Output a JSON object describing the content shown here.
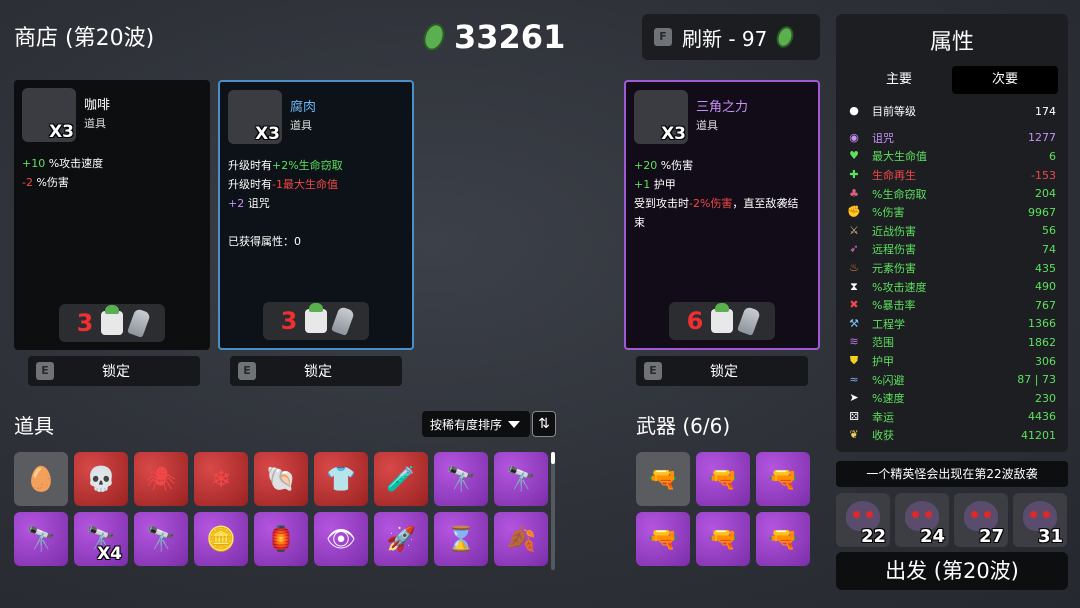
{
  "shop_title": "商店 (第20波)",
  "currency": "33261",
  "refresh": {
    "key": "F",
    "label": "刷新 - 97"
  },
  "cards": [
    {
      "name": "咖啡",
      "type": "道具",
      "qty": "X3",
      "rarity": "common",
      "effects": [
        [
          {
            "t": "+10",
            "c": "green"
          },
          {
            "t": " %攻击速度",
            "c": ""
          }
        ],
        [
          {
            "t": "-2",
            "c": "red"
          },
          {
            "t": " %伤害",
            "c": ""
          }
        ]
      ],
      "price": "3",
      "lock_key": "E",
      "lock_label": "锁定"
    },
    {
      "name": "腐肉",
      "type": "道具",
      "qty": "X3",
      "rarity": "blue",
      "effects": [
        [
          {
            "t": "升级时有",
            "c": ""
          },
          {
            "t": "+2%生命窃取",
            "c": "green"
          }
        ],
        [
          {
            "t": "升级时有",
            "c": ""
          },
          {
            "t": "-1最大生命值",
            "c": "red"
          }
        ],
        [
          {
            "t": "+2",
            "c": "purp"
          },
          {
            "t": " 诅咒",
            "c": ""
          }
        ],
        [
          {
            "t": "",
            "c": ""
          }
        ],
        [
          {
            "t": "已获得属性：0",
            "c": ""
          }
        ]
      ],
      "price": "3",
      "lock_key": "E",
      "lock_label": "锁定"
    },
    {
      "name": "三角之力",
      "type": "道具",
      "qty": "X3",
      "rarity": "purple",
      "effects": [
        [
          {
            "t": "+20",
            "c": "green"
          },
          {
            "t": " %伤害",
            "c": ""
          }
        ],
        [
          {
            "t": "+1",
            "c": "green"
          },
          {
            "t": " 护甲",
            "c": ""
          }
        ],
        [
          {
            "t": "受到攻击时",
            "c": ""
          },
          {
            "t": "-2%伤害",
            "c": "red"
          },
          {
            "t": "，直至敌袭结",
            "c": ""
          }
        ],
        [
          {
            "t": "束",
            "c": ""
          }
        ]
      ],
      "price": "6",
      "lock_key": "E",
      "lock_label": "锁定"
    }
  ],
  "items_title": "道具",
  "sort_label": "按稀有度排序",
  "items": [
    {
      "icon": "egg-icon",
      "glyph": "🥚",
      "rarity": "white",
      "qty": ""
    },
    {
      "icon": "skull-helmet-icon",
      "glyph": "💀",
      "rarity": "red",
      "qty": ""
    },
    {
      "icon": "spider-icon",
      "glyph": "🕷",
      "rarity": "red",
      "qty": ""
    },
    {
      "icon": "snowflake-orb-icon",
      "glyph": "❄",
      "rarity": "red",
      "qty": ""
    },
    {
      "icon": "shell-icon",
      "glyph": "🐚",
      "rarity": "red",
      "qty": ""
    },
    {
      "icon": "hoodie-icon",
      "glyph": "👕",
      "rarity": "red",
      "qty": ""
    },
    {
      "icon": "test-tube-icon",
      "glyph": "🧪",
      "rarity": "red",
      "qty": ""
    },
    {
      "icon": "binoculars-icon",
      "glyph": "🔭",
      "rarity": "purple",
      "qty": ""
    },
    {
      "icon": "binoculars-icon",
      "glyph": "🔭",
      "rarity": "purple",
      "qty": ""
    },
    {
      "icon": "binoculars-icon",
      "glyph": "🔭",
      "rarity": "purple",
      "qty": ""
    },
    {
      "icon": "binoculars-icon",
      "glyph": "🔭",
      "rarity": "purple",
      "qty": "X4"
    },
    {
      "icon": "binoculars-icon",
      "glyph": "🔭",
      "rarity": "purple",
      "qty": ""
    },
    {
      "icon": "coin-icon",
      "glyph": "🪙",
      "rarity": "purple",
      "qty": ""
    },
    {
      "icon": "lantern-icon",
      "glyph": "🏮",
      "rarity": "purple",
      "qty": ""
    },
    {
      "icon": "eye-icon",
      "glyph": "👁",
      "rarity": "purple",
      "qty": ""
    },
    {
      "icon": "rocket-icon",
      "glyph": "🚀",
      "rarity": "purple",
      "qty": ""
    },
    {
      "icon": "hourglass-skull-icon",
      "glyph": "⌛",
      "rarity": "purple",
      "qty": ""
    },
    {
      "icon": "rainbow-leaf-icon",
      "glyph": "🍂",
      "rarity": "purple",
      "qty": ""
    }
  ],
  "weapons_title": "武器 (6/6)",
  "weapons": [
    {
      "icon": "minigun-icon",
      "glyph": "🔫",
      "rarity": "white"
    },
    {
      "icon": "minigun-icon",
      "glyph": "🔫",
      "rarity": "purple"
    },
    {
      "icon": "minigun-icon",
      "glyph": "🔫",
      "rarity": "purple"
    },
    {
      "icon": "minigun-icon",
      "glyph": "🔫",
      "rarity": "purple"
    },
    {
      "icon": "minigun-icon",
      "glyph": "🔫",
      "rarity": "purple"
    },
    {
      "icon": "minigun-icon",
      "glyph": "🔫",
      "rarity": "purple"
    }
  ],
  "stats": {
    "title": "属性",
    "tab_main": "主要",
    "tab_secondary": "次要",
    "rows": [
      {
        "icon": "level-icon",
        "glyph": "●",
        "label": "目前等级",
        "value": "174",
        "color": "#ffffff",
        "icolor": "#ffffff"
      },
      {
        "icon": "curse-icon",
        "glyph": "◉",
        "label": "诅咒",
        "value": "1277",
        "color": "#c890f8",
        "icolor": "#c890f8"
      },
      {
        "icon": "heart-icon",
        "glyph": "♥",
        "label": "最大生命值",
        "value": "6",
        "color": "#5ee05e",
        "icolor": "#5ee05e"
      },
      {
        "icon": "regen-icon",
        "glyph": "✚",
        "label": "生命再生",
        "value": "-153",
        "color": "#f04848",
        "icolor": "#5ee05e"
      },
      {
        "icon": "lifesteal-icon",
        "glyph": "♣",
        "label": "%生命窃取",
        "value": "204",
        "color": "#5ee05e",
        "icolor": "#e06080"
      },
      {
        "icon": "damage-icon",
        "glyph": "✊",
        "label": "%伤害",
        "value": "9967",
        "color": "#5ee05e",
        "icolor": "#e07060"
      },
      {
        "icon": "melee-icon",
        "glyph": "⚔",
        "label": "近战伤害",
        "value": "56",
        "color": "#5ee05e",
        "icolor": "#e0c080"
      },
      {
        "icon": "ranged-icon",
        "glyph": "➶",
        "label": "远程伤害",
        "value": "74",
        "color": "#5ee05e",
        "icolor": "#e070d0"
      },
      {
        "icon": "elemental-icon",
        "glyph": "♨",
        "label": "元素伤害",
        "value": "435",
        "color": "#5ee05e",
        "icolor": "#f08040"
      },
      {
        "icon": "attack-speed-icon",
        "glyph": "⧗",
        "label": "%攻击速度",
        "value": "490",
        "color": "#5ee05e",
        "icolor": "#ffffff"
      },
      {
        "icon": "crit-icon",
        "glyph": "✖",
        "label": "%暴击率",
        "value": "767",
        "color": "#5ee05e",
        "icolor": "#f04848"
      },
      {
        "icon": "engineering-icon",
        "glyph": "⚒",
        "label": "工程学",
        "value": "1366",
        "color": "#5ee05e",
        "icolor": "#80c0f0"
      },
      {
        "icon": "range-icon",
        "glyph": "≋",
        "label": "范围",
        "value": "1862",
        "color": "#5ee05e",
        "icolor": "#c070e0"
      },
      {
        "icon": "armor-icon",
        "glyph": "⛊",
        "label": "护甲",
        "value": "306",
        "color": "#5ee05e",
        "icolor": "#f0d020"
      },
      {
        "icon": "dodge-icon",
        "glyph": "≈",
        "label": "%闪避",
        "value": "87 | 73",
        "color": "#5ee05e",
        "icolor": "#80b0f0"
      },
      {
        "icon": "speed-icon",
        "glyph": "➤",
        "label": "%速度",
        "value": "230",
        "color": "#5ee05e",
        "icolor": "#ffffff"
      },
      {
        "icon": "luck-icon",
        "glyph": "⚄",
        "label": "幸运",
        "value": "4436",
        "color": "#5ee05e",
        "icolor": "#ffffff"
      },
      {
        "icon": "harvesting-icon",
        "glyph": "❦",
        "label": "收获",
        "value": "41201",
        "color": "#5ee05e",
        "icolor": "#f0d060"
      }
    ]
  },
  "elite_notice": "一个精英怪会出现在第22波敌袭",
  "bosses": [
    {
      "icon": "boss-icon",
      "wave": "22"
    },
    {
      "icon": "boss-icon",
      "wave": "24"
    },
    {
      "icon": "boss-icon",
      "wave": "27"
    },
    {
      "icon": "boss-icon",
      "wave": "31"
    }
  ],
  "go_label": "出发 (第20波)"
}
